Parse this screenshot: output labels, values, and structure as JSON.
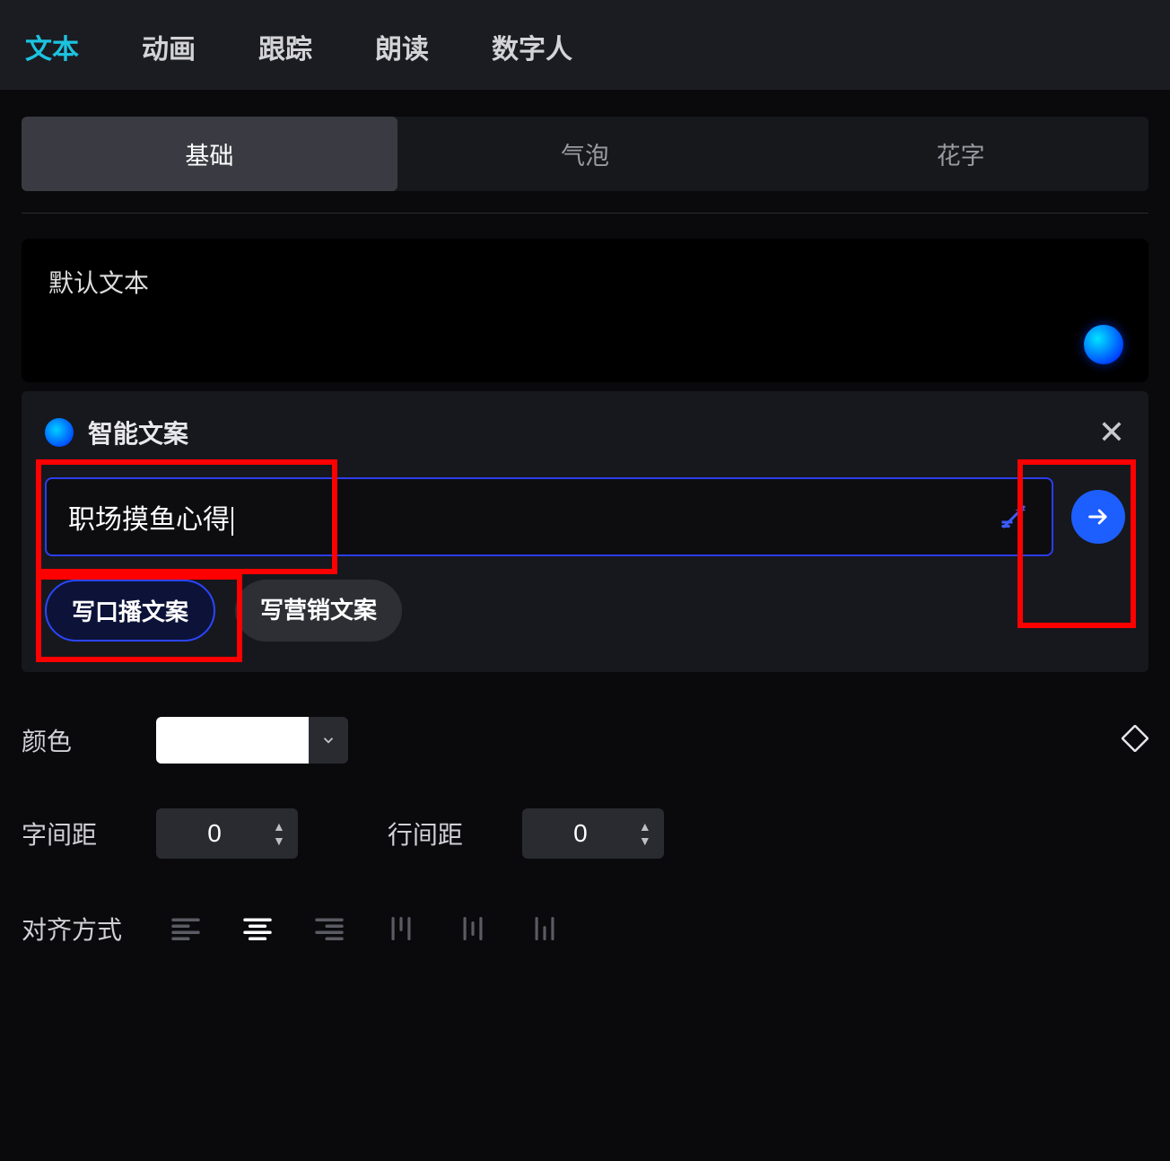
{
  "top_tabs": {
    "text": "文本",
    "anim": "动画",
    "track": "跟踪",
    "read": "朗读",
    "avatar": "数字人"
  },
  "subtabs": {
    "basic": "基础",
    "bubble": "气泡",
    "fancy": "花字"
  },
  "textbox": {
    "value": "默认文本"
  },
  "panel": {
    "title": "智能文案",
    "input_value": "职场摸鱼心得",
    "chip_script": "写口播文案",
    "chip_marketing": "写营销文案"
  },
  "form": {
    "color_label": "颜色",
    "color_value": "#FFFFFF",
    "letter_spacing_label": "字间距",
    "letter_spacing_value": "0",
    "line_spacing_label": "行间距",
    "line_spacing_value": "0",
    "align_label": "对齐方式"
  }
}
